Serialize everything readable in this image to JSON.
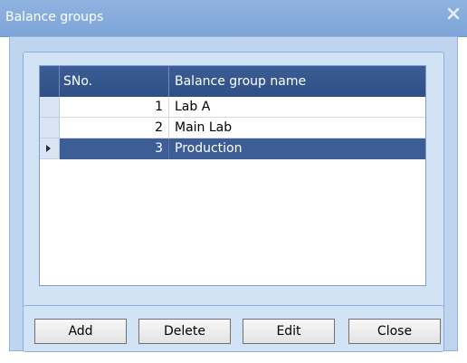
{
  "window": {
    "title": "Balance groups"
  },
  "grid": {
    "columns": [
      "SNo.",
      "Balance group name"
    ],
    "rows": [
      {
        "sno": "1",
        "name": "Lab A",
        "selected": false
      },
      {
        "sno": "2",
        "name": "Main Lab",
        "selected": false
      },
      {
        "sno": "3",
        "name": "Production",
        "selected": true
      }
    ]
  },
  "buttons": {
    "add": "Add",
    "delete": "Delete",
    "edit": "Edit",
    "close": "Close"
  },
  "colors": {
    "titlebar": "#7ea5d8",
    "header": "#2f4f86",
    "selected_row": "#3c5d95",
    "panel": "#bfd4ee"
  },
  "icons": {
    "close": "close-icon",
    "row_indicator": "triangle-right-icon"
  }
}
